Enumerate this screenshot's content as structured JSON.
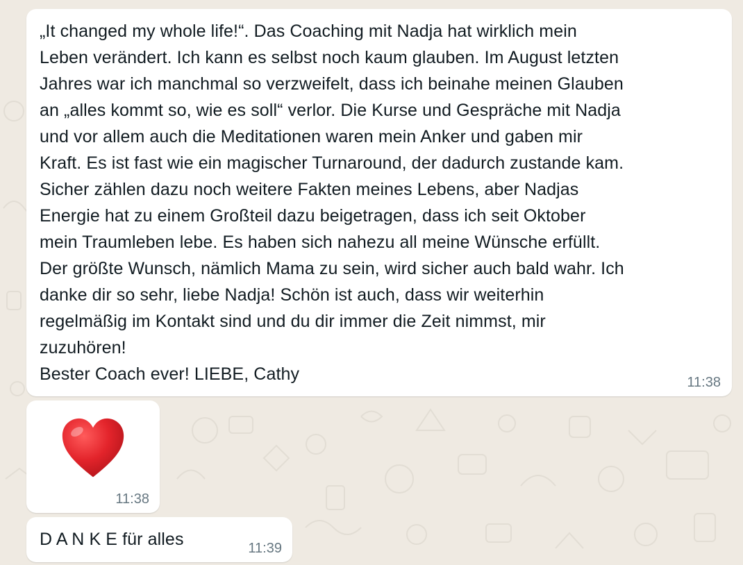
{
  "chat": {
    "messages": [
      {
        "paragraphs": [
          "„It changed my whole life!“. Das Coaching mit Nadja hat wirklich mein\nLeben verändert. Ich kann es selbst noch kaum glauben. Im August letzten\nJahres war ich manchmal so verzweifelt, dass ich beinahe meinen Glauben\nan „alles kommt so, wie es soll“ verlor. Die Kurse und Gespräche mit Nadja\nund vor allem auch die Meditationen waren mein Anker und gaben mir\nKraft. Es ist fast wie ein magischer Turnaround, der dadurch zustande kam.\nSicher zählen dazu noch weitere Fakten meines Lebens, aber Nadjas\nEnergie hat zu einem Großteil dazu beigetragen, dass ich seit Oktober\nmein Traumleben lebe. Es haben sich nahezu all meine Wünsche erfüllt.\nDer größte Wunsch, nämlich Mama zu sein, wird sicher auch bald wahr. Ich\ndanke dir so sehr, liebe Nadja! Schön ist auch, dass wir weiterhin\nregelmäßig im Kontakt sind und du dir immer die Zeit nimmst, mir\nzuzuhören!",
          "Bester Coach ever! LIEBE, Cathy"
        ],
        "time": "11:38"
      },
      {
        "emoji": "red-heart",
        "time": "11:38"
      },
      {
        "text": "D A N K E für alles",
        "time": "11:39"
      }
    ]
  },
  "colors": {
    "chat_background": "#efeae2",
    "bubble_background": "#ffffff",
    "text": "#111b21",
    "timestamp": "#667781",
    "heart": "#e3242b"
  }
}
